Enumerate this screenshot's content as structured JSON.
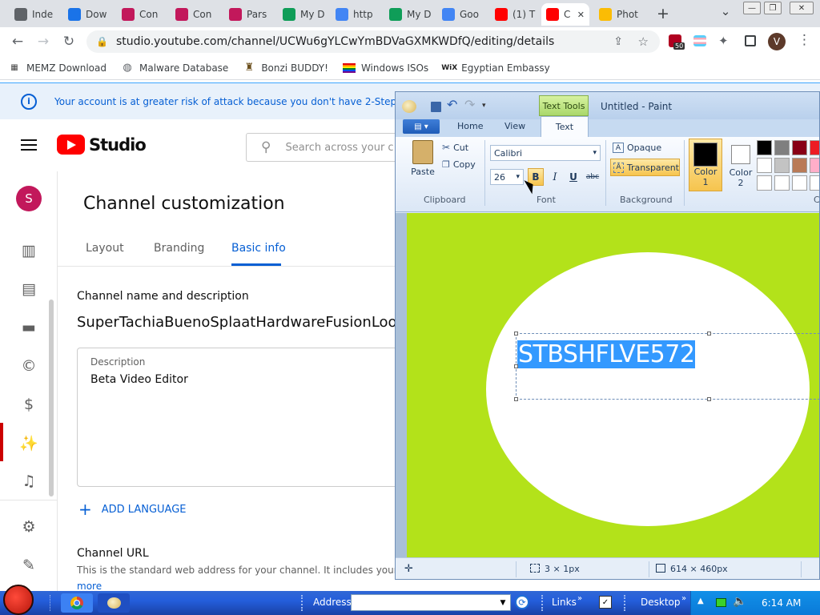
{
  "browser": {
    "tabs": [
      {
        "label": "Inde",
        "icon": "globe-icon",
        "color": "#5f6368"
      },
      {
        "label": "Dow",
        "icon": "download-icon",
        "color": "#1a73e8"
      },
      {
        "label": "Con",
        "icon": "bonanza-icon",
        "color": "#c2185b"
      },
      {
        "label": "Con",
        "icon": "bonanza-icon",
        "color": "#c2185b"
      },
      {
        "label": "Pars",
        "icon": "bonanza-icon",
        "color": "#c2185b"
      },
      {
        "label": "My D",
        "icon": "google-drive-icon",
        "color": "#0f9d58"
      },
      {
        "label": "http",
        "icon": "google-docs-icon",
        "color": "#4285f4"
      },
      {
        "label": "My D",
        "icon": "google-drive-icon",
        "color": "#0f9d58"
      },
      {
        "label": "Goo",
        "icon": "google-docs-icon",
        "color": "#4285f4"
      },
      {
        "label": "(1) T",
        "icon": "youtube-icon",
        "color": "#ff0000"
      },
      {
        "label": "C",
        "icon": "youtube-icon",
        "color": "#ff0000"
      },
      {
        "label": "Phot",
        "icon": "google-photos-icon",
        "color": "#fbbc04"
      }
    ],
    "new_tab": "+",
    "tab_search": "⌄",
    "url": "studio.youtube.com/channel/UCWu6gYLCwYmBDVaGXMKWDfQ/editing/details",
    "extension_badge": "50",
    "profile_initial": "V",
    "bookmarks": [
      "MEMZ Download",
      "Malware Database",
      "Bonzi BUDDY!",
      "Windows ISOs",
      "Egyptian Embassy"
    ]
  },
  "studio": {
    "banner_text": "Your account is at greater risk of attack because you don't have 2-Step",
    "logo_text": "Studio",
    "search_placeholder": "Search across your c",
    "avatar_initial": "S",
    "page_title": "Channel customization",
    "tabs": [
      "Layout",
      "Branding",
      "Basic info"
    ],
    "active_tab": "Basic info",
    "section_name_desc": "Channel name and description",
    "channel_name": "SuperTachiaBuenoSplaatHardwareFusionLoo",
    "description_label": "Description",
    "description_value": "Beta Video Editor",
    "add_language": "ADD LANGUAGE",
    "channel_url_heading": "Channel URL",
    "channel_url_text": "This is the standard web address for your channel. It includes your un",
    "more_link": "more",
    "accent": "#065fd4",
    "brand_red": "#ff0000"
  },
  "paint": {
    "contextual_tab": "Text Tools",
    "title": "Untitled - Paint",
    "ribbon_tabs": [
      "Home",
      "View",
      "Text"
    ],
    "active_ribbon_tab": "Text",
    "clipboard": {
      "paste": "Paste",
      "cut": "Cut",
      "copy": "Copy",
      "group": "Clipboard"
    },
    "font": {
      "family": "Calibri",
      "size": "26",
      "bold": "B",
      "italic": "I",
      "underline": "U",
      "strike": "abc",
      "group": "Font"
    },
    "background": {
      "opaque": "Opaque",
      "transparent": "Transparent",
      "group": "Background"
    },
    "colors": {
      "color1": "Color 1",
      "color2": "Color 2",
      "group_partial": "C"
    },
    "palette": [
      "#000000",
      "#7f7f7f",
      "#880015",
      "#ed1c24",
      "#ffffff",
      "#c3c3c3",
      "#b97a57",
      "#ffaec9",
      "#ffffff",
      "#ffffff",
      "#ffffff",
      "#ffffff"
    ],
    "canvas_bg": "#b3e21a",
    "text_content": "STBSHFLVE572",
    "selection_color": "#3399ff",
    "status_selection": "3 × 1px",
    "status_size": "614 × 460px"
  },
  "taskbar": {
    "address_label": "Address",
    "links_label": "Links",
    "desktop_label": "Desktop",
    "clock": "6:14 AM"
  }
}
